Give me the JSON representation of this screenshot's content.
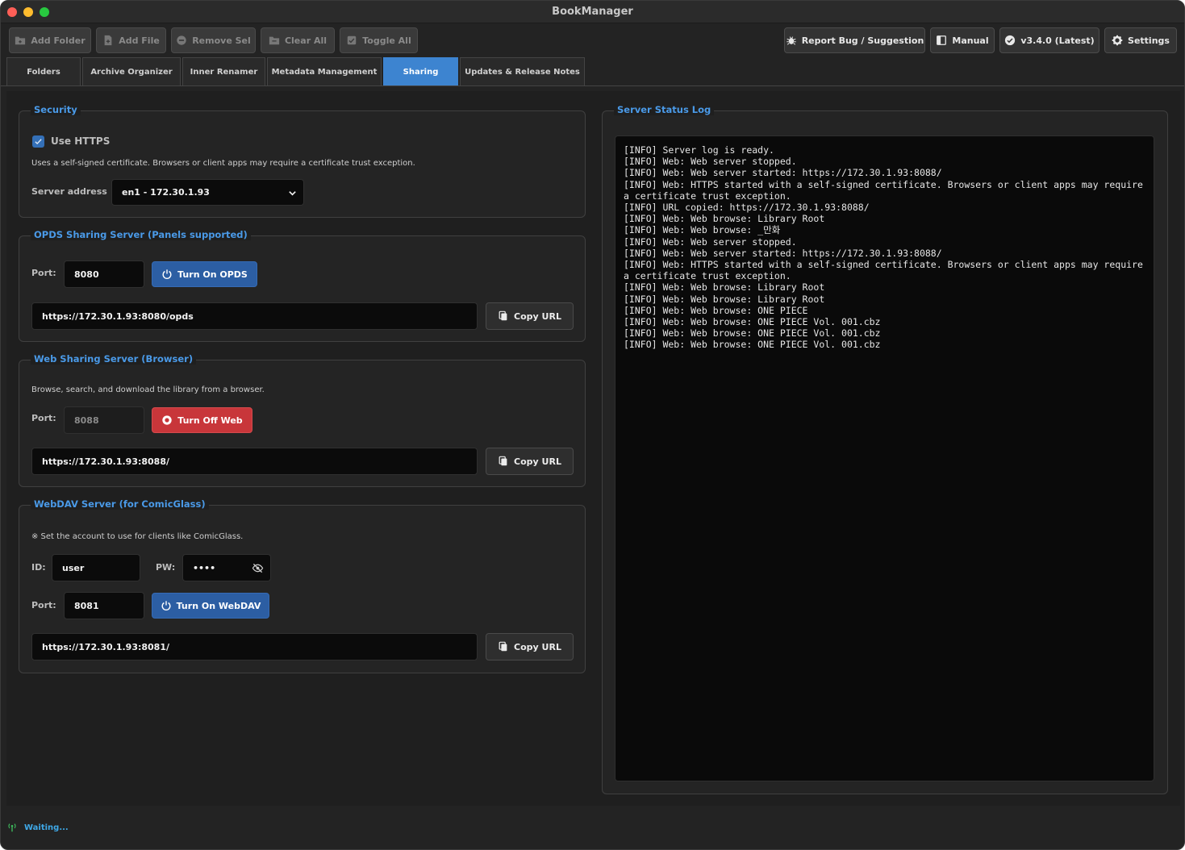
{
  "window": {
    "title": "BookManager"
  },
  "toolbar": {
    "add_folder": "Add Folder",
    "add_file": "Add File",
    "remove_sel": "Remove Sel",
    "clear_all": "Clear All",
    "toggle_all": "Toggle All",
    "report_bug": "Report Bug / Suggestion",
    "manual": "Manual",
    "version": "v3.4.0 (Latest)",
    "settings": "Settings"
  },
  "tabs": [
    "Folders",
    "Archive Organizer",
    "Inner Renamer",
    "Metadata Management",
    "Sharing",
    "Updates & Release Notes"
  ],
  "active_tab": "Sharing",
  "security": {
    "title": "Security",
    "use_https_label": "Use HTTPS",
    "use_https_checked": true,
    "description": "Uses a self-signed certificate. Browsers or client apps may require a certificate trust exception.",
    "server_address_label": "Server address",
    "server_address_value": "en1 - 172.30.1.93"
  },
  "opds": {
    "title": "OPDS Sharing Server (Panels supported)",
    "port_label": "Port:",
    "port_value": "8080",
    "toggle_label": "Turn On OPDS",
    "url": "https://172.30.1.93:8080/opds",
    "copy_label": "Copy URL"
  },
  "web": {
    "title": "Web Sharing Server (Browser)",
    "description": "Browse, search, and download the library from a browser.",
    "port_label": "Port:",
    "port_value": "8088",
    "toggle_label": "Turn Off Web",
    "url": "https://172.30.1.93:8088/",
    "copy_label": "Copy URL"
  },
  "webdav": {
    "title": "WebDAV Server (for ComicGlass)",
    "description": "※ Set the account to use for clients like ComicGlass.",
    "id_label": "ID:",
    "id_value": "user",
    "pw_label": "PW:",
    "pw_value": "••••",
    "port_label": "Port:",
    "port_value": "8081",
    "toggle_label": "Turn On WebDAV",
    "url": "https://172.30.1.93:8081/",
    "copy_label": "Copy URL"
  },
  "log": {
    "title": "Server Status Log",
    "lines": [
      "[INFO] Server log is ready.",
      "[INFO] Web: Web server stopped.",
      "[INFO] Web: Web server started: https://172.30.1.93:8088/",
      "[INFO] Web: HTTPS started with a self-signed certificate. Browsers or client apps may require a certificate trust exception.",
      "[INFO] URL copied: https://172.30.1.93:8088/",
      "[INFO] Web: Web browse: Library Root",
      "[INFO] Web: Web browse: _만화",
      "[INFO] Web: Web server stopped.",
      "[INFO] Web: Web server started: https://172.30.1.93:8088/",
      "[INFO] Web: HTTPS started with a self-signed certificate. Browsers or client apps may require a certificate trust exception.",
      "[INFO] Web: Web browse: Library Root",
      "[INFO] Web: Web browse: Library Root",
      "[INFO] Web: Web browse: ONE PIECE",
      "[INFO] Web: Web browse: ONE PIECE Vol. 001.cbz",
      "[INFO] Web: Web browse: ONE PIECE Vol. 001.cbz",
      "[INFO] Web: Web browse: ONE PIECE Vol. 001.cbz"
    ]
  },
  "status": {
    "text": "Waiting..."
  },
  "colors": {
    "accent": "#3d84d0",
    "group_title": "#4a9ae8",
    "danger": "#c8363a",
    "primary_button": "#2c5ea3"
  }
}
